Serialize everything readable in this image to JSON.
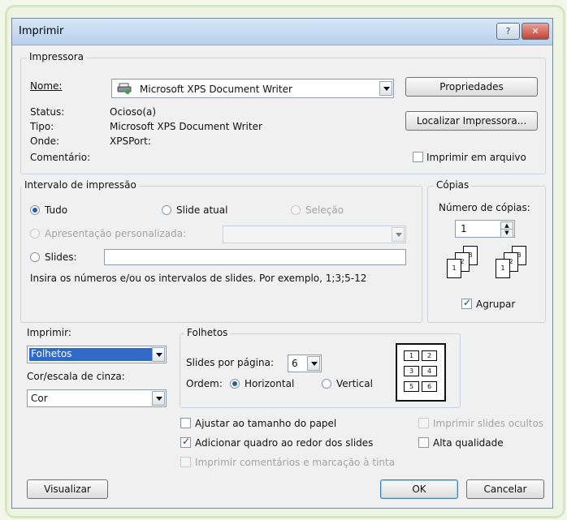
{
  "window": {
    "title": "Imprimir",
    "help_glyph": "?",
    "close_glyph": "✕"
  },
  "printer": {
    "group_label": "Impressora",
    "name_label": "Nome:",
    "name_value": "Microsoft XPS Document Writer",
    "properties_button": "Propriedades",
    "find_button": "Localizar Impressora...",
    "status_label": "Status:",
    "status_value": "Ocioso(a)",
    "type_label": "Tipo:",
    "type_value": "Microsoft XPS Document Writer",
    "where_label": "Onde:",
    "where_value": "XPSPort:",
    "comment_label": "Comentário:",
    "print_to_file_label": "Imprimir em arquivo"
  },
  "range": {
    "group_label": "Intervalo de impressão",
    "all_label": "Tudo",
    "current_slide_label": "Slide atual",
    "selection_label": "Seleção",
    "custom_show_label": "Apresentação personalizada:",
    "slides_label": "Slides:",
    "hint": "Insira os números e/ou os intervalos de slides. Por exemplo, 1;3;5-12"
  },
  "copies": {
    "group_label": "Cópias",
    "count_label": "Número de cópias:",
    "count_value": "1",
    "collate_label": "Agrupar",
    "stack_numbers": [
      "1",
      "2",
      "3"
    ]
  },
  "print_what": {
    "label": "Imprimir:",
    "value": "Folhetos"
  },
  "color": {
    "label": "Cor/escala de cinza:",
    "value": "Cor"
  },
  "handouts": {
    "group_label": "Folhetos",
    "per_page_label": "Slides por página:",
    "per_page_value": "6",
    "order_label": "Ordem:",
    "horizontal_label": "Horizontal",
    "vertical_label": "Vertical",
    "preview_numbers": [
      "1",
      "2",
      "3",
      "4",
      "5",
      "6"
    ]
  },
  "options": {
    "fit_label": "Ajustar ao tamanho do papel",
    "frame_label": "Adicionar quadro ao redor dos slides",
    "comments_label": "Imprimir comentários e marcação à tinta",
    "hidden_label": "Imprimir slides ocultos",
    "quality_label": "Alta qualidade"
  },
  "buttons": {
    "preview": "Visualizar",
    "ok": "OK",
    "cancel": "Cancelar"
  }
}
